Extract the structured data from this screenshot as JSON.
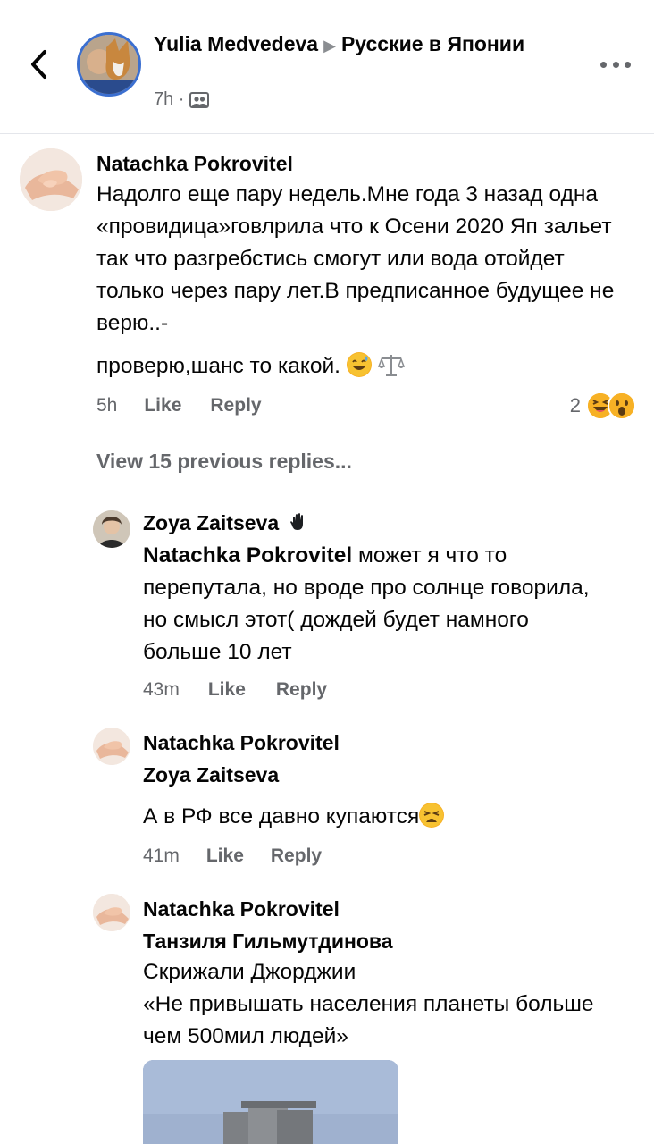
{
  "header": {
    "poster_name": "Yulia Medvedeva",
    "arrow": "▶",
    "group_name": "Русские в Японии",
    "time": "7h ·",
    "audience_icon": "group-audience-icon",
    "avatar_badge": "#STAYHOME"
  },
  "comment_main": {
    "author": "Natachka Pokrovitel",
    "text_line1": "Надолго еще пару недель.Мне года 3 назад одна «провидица»говлрила что к Осени 2020 Яп зальет так что разгребстись смогут или вода отойдет только через пару лет.В предписанное будущее не верю..-",
    "text_line2": "проверю,шанс то какой.",
    "time": "5h",
    "like": "Like",
    "reply": "Reply",
    "reaction_count": "2"
  },
  "view_previous": "View 15 previous replies...",
  "replies": [
    {
      "author": "Zoya Zaitseva",
      "mention": "Natachka Pokrovitel",
      "text": " может я что то перепутала, но вроде про солнце говорила, но смысл этот( дождей будет намного больше 10 лет",
      "time": "43m",
      "like": "Like",
      "reply": "Reply"
    },
    {
      "author": "Natachka Pokrovitel",
      "mention": "Zoya Zaitseva",
      "text": "А в РФ все давно купаются",
      "time": "41m",
      "like": "Like",
      "reply": "Reply"
    },
    {
      "author": "Natachka Pokrovitel",
      "mention": "Танзиля Гильмутдинова",
      "text_line1": "Скрижали Джорджии",
      "text_line2": "«Не привышать населения планеты больше чем 500мил людей»"
    }
  ],
  "colors": {
    "text": "#050505",
    "secondary": "#65676b",
    "divider": "#e4e6eb",
    "reaction": "#f7b125"
  }
}
